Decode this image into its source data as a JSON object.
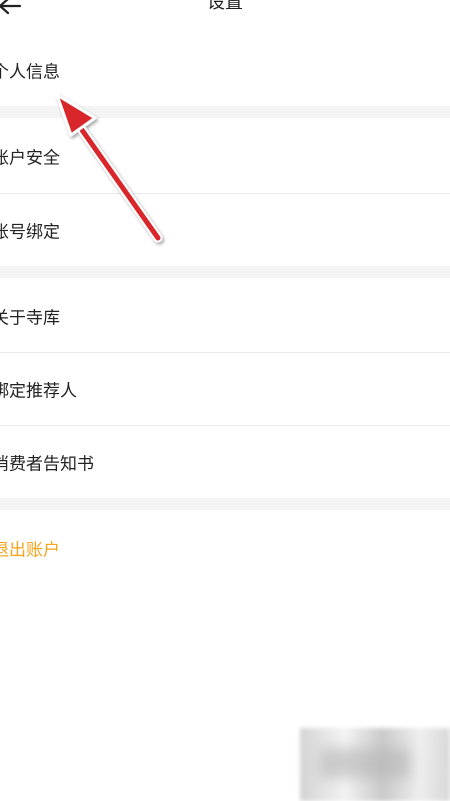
{
  "header": {
    "title": "设置"
  },
  "groups": [
    {
      "items": [
        {
          "label": "个人信息"
        }
      ]
    },
    {
      "items": [
        {
          "label": "账户安全"
        },
        {
          "label": "账号绑定"
        }
      ]
    },
    {
      "items": [
        {
          "label": "关于寺库"
        },
        {
          "label": "绑定推荐人"
        },
        {
          "label": "消费者告知书"
        }
      ]
    },
    {
      "items": [
        {
          "label": "退出账户"
        }
      ]
    }
  ],
  "colors": {
    "logout_text": "#f3a41c",
    "annotation_arrow": "#d8262a",
    "group_gap": "#f4f4f4"
  },
  "icons": {
    "back": "arrow-left-icon"
  }
}
